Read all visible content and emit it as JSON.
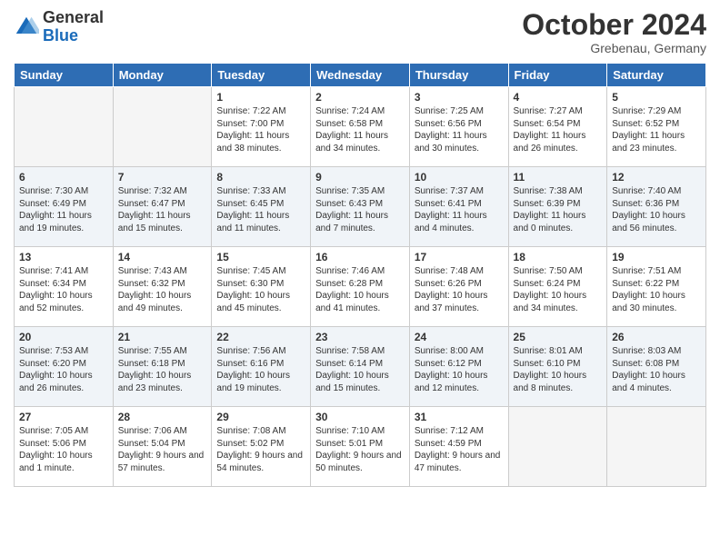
{
  "header": {
    "logo_general": "General",
    "logo_blue": "Blue",
    "month_title": "October 2024",
    "location": "Grebenau, Germany"
  },
  "days_of_week": [
    "Sunday",
    "Monday",
    "Tuesday",
    "Wednesday",
    "Thursday",
    "Friday",
    "Saturday"
  ],
  "weeks": [
    {
      "shade": false,
      "days": [
        {
          "num": "",
          "sunrise": "",
          "sunset": "",
          "daylight": ""
        },
        {
          "num": "",
          "sunrise": "",
          "sunset": "",
          "daylight": ""
        },
        {
          "num": "1",
          "sunrise": "Sunrise: 7:22 AM",
          "sunset": "Sunset: 7:00 PM",
          "daylight": "Daylight: 11 hours and 38 minutes."
        },
        {
          "num": "2",
          "sunrise": "Sunrise: 7:24 AM",
          "sunset": "Sunset: 6:58 PM",
          "daylight": "Daylight: 11 hours and 34 minutes."
        },
        {
          "num": "3",
          "sunrise": "Sunrise: 7:25 AM",
          "sunset": "Sunset: 6:56 PM",
          "daylight": "Daylight: 11 hours and 30 minutes."
        },
        {
          "num": "4",
          "sunrise": "Sunrise: 7:27 AM",
          "sunset": "Sunset: 6:54 PM",
          "daylight": "Daylight: 11 hours and 26 minutes."
        },
        {
          "num": "5",
          "sunrise": "Sunrise: 7:29 AM",
          "sunset": "Sunset: 6:52 PM",
          "daylight": "Daylight: 11 hours and 23 minutes."
        }
      ]
    },
    {
      "shade": true,
      "days": [
        {
          "num": "6",
          "sunrise": "Sunrise: 7:30 AM",
          "sunset": "Sunset: 6:49 PM",
          "daylight": "Daylight: 11 hours and 19 minutes."
        },
        {
          "num": "7",
          "sunrise": "Sunrise: 7:32 AM",
          "sunset": "Sunset: 6:47 PM",
          "daylight": "Daylight: 11 hours and 15 minutes."
        },
        {
          "num": "8",
          "sunrise": "Sunrise: 7:33 AM",
          "sunset": "Sunset: 6:45 PM",
          "daylight": "Daylight: 11 hours and 11 minutes."
        },
        {
          "num": "9",
          "sunrise": "Sunrise: 7:35 AM",
          "sunset": "Sunset: 6:43 PM",
          "daylight": "Daylight: 11 hours and 7 minutes."
        },
        {
          "num": "10",
          "sunrise": "Sunrise: 7:37 AM",
          "sunset": "Sunset: 6:41 PM",
          "daylight": "Daylight: 11 hours and 4 minutes."
        },
        {
          "num": "11",
          "sunrise": "Sunrise: 7:38 AM",
          "sunset": "Sunset: 6:39 PM",
          "daylight": "Daylight: 11 hours and 0 minutes."
        },
        {
          "num": "12",
          "sunrise": "Sunrise: 7:40 AM",
          "sunset": "Sunset: 6:36 PM",
          "daylight": "Daylight: 10 hours and 56 minutes."
        }
      ]
    },
    {
      "shade": false,
      "days": [
        {
          "num": "13",
          "sunrise": "Sunrise: 7:41 AM",
          "sunset": "Sunset: 6:34 PM",
          "daylight": "Daylight: 10 hours and 52 minutes."
        },
        {
          "num": "14",
          "sunrise": "Sunrise: 7:43 AM",
          "sunset": "Sunset: 6:32 PM",
          "daylight": "Daylight: 10 hours and 49 minutes."
        },
        {
          "num": "15",
          "sunrise": "Sunrise: 7:45 AM",
          "sunset": "Sunset: 6:30 PM",
          "daylight": "Daylight: 10 hours and 45 minutes."
        },
        {
          "num": "16",
          "sunrise": "Sunrise: 7:46 AM",
          "sunset": "Sunset: 6:28 PM",
          "daylight": "Daylight: 10 hours and 41 minutes."
        },
        {
          "num": "17",
          "sunrise": "Sunrise: 7:48 AM",
          "sunset": "Sunset: 6:26 PM",
          "daylight": "Daylight: 10 hours and 37 minutes."
        },
        {
          "num": "18",
          "sunrise": "Sunrise: 7:50 AM",
          "sunset": "Sunset: 6:24 PM",
          "daylight": "Daylight: 10 hours and 34 minutes."
        },
        {
          "num": "19",
          "sunrise": "Sunrise: 7:51 AM",
          "sunset": "Sunset: 6:22 PM",
          "daylight": "Daylight: 10 hours and 30 minutes."
        }
      ]
    },
    {
      "shade": true,
      "days": [
        {
          "num": "20",
          "sunrise": "Sunrise: 7:53 AM",
          "sunset": "Sunset: 6:20 PM",
          "daylight": "Daylight: 10 hours and 26 minutes."
        },
        {
          "num": "21",
          "sunrise": "Sunrise: 7:55 AM",
          "sunset": "Sunset: 6:18 PM",
          "daylight": "Daylight: 10 hours and 23 minutes."
        },
        {
          "num": "22",
          "sunrise": "Sunrise: 7:56 AM",
          "sunset": "Sunset: 6:16 PM",
          "daylight": "Daylight: 10 hours and 19 minutes."
        },
        {
          "num": "23",
          "sunrise": "Sunrise: 7:58 AM",
          "sunset": "Sunset: 6:14 PM",
          "daylight": "Daylight: 10 hours and 15 minutes."
        },
        {
          "num": "24",
          "sunrise": "Sunrise: 8:00 AM",
          "sunset": "Sunset: 6:12 PM",
          "daylight": "Daylight: 10 hours and 12 minutes."
        },
        {
          "num": "25",
          "sunrise": "Sunrise: 8:01 AM",
          "sunset": "Sunset: 6:10 PM",
          "daylight": "Daylight: 10 hours and 8 minutes."
        },
        {
          "num": "26",
          "sunrise": "Sunrise: 8:03 AM",
          "sunset": "Sunset: 6:08 PM",
          "daylight": "Daylight: 10 hours and 4 minutes."
        }
      ]
    },
    {
      "shade": false,
      "days": [
        {
          "num": "27",
          "sunrise": "Sunrise: 7:05 AM",
          "sunset": "Sunset: 5:06 PM",
          "daylight": "Daylight: 10 hours and 1 minute."
        },
        {
          "num": "28",
          "sunrise": "Sunrise: 7:06 AM",
          "sunset": "Sunset: 5:04 PM",
          "daylight": "Daylight: 9 hours and 57 minutes."
        },
        {
          "num": "29",
          "sunrise": "Sunrise: 7:08 AM",
          "sunset": "Sunset: 5:02 PM",
          "daylight": "Daylight: 9 hours and 54 minutes."
        },
        {
          "num": "30",
          "sunrise": "Sunrise: 7:10 AM",
          "sunset": "Sunset: 5:01 PM",
          "daylight": "Daylight: 9 hours and 50 minutes."
        },
        {
          "num": "31",
          "sunrise": "Sunrise: 7:12 AM",
          "sunset": "Sunset: 4:59 PM",
          "daylight": "Daylight: 9 hours and 47 minutes."
        },
        {
          "num": "",
          "sunrise": "",
          "sunset": "",
          "daylight": ""
        },
        {
          "num": "",
          "sunrise": "",
          "sunset": "",
          "daylight": ""
        }
      ]
    }
  ]
}
